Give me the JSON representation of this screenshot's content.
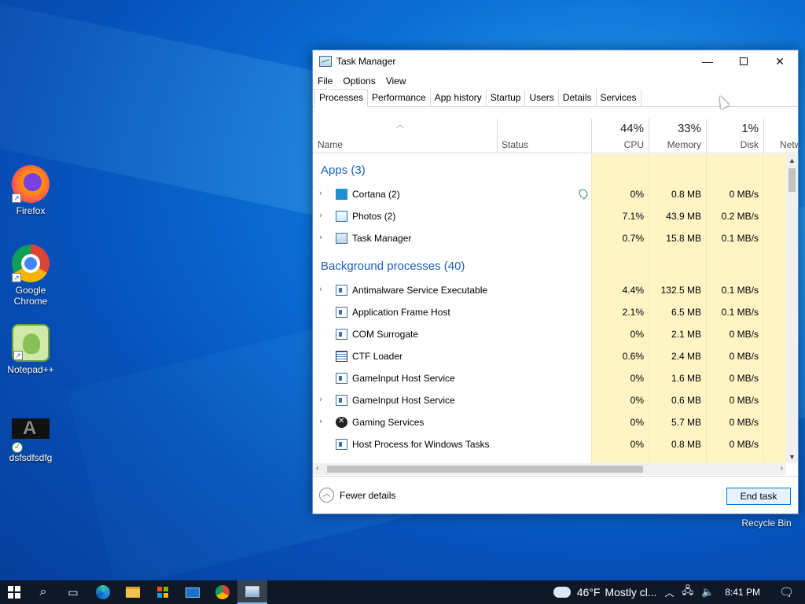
{
  "desktop": {
    "icons": [
      {
        "label": "Firefox"
      },
      {
        "label": "Google Chrome"
      },
      {
        "label": "Notepad++"
      },
      {
        "label": "dsfsdfsdfg"
      },
      {
        "label": "Recycle Bin"
      }
    ]
  },
  "window": {
    "title": "Task Manager",
    "menu": [
      "File",
      "Options",
      "View"
    ],
    "tabs": [
      "Processes",
      "Performance",
      "App history",
      "Startup",
      "Users",
      "Details",
      "Services"
    ],
    "active_tab": "Processes"
  },
  "columns": {
    "name": "Name",
    "status": "Status",
    "cpu": {
      "percent": "44%",
      "label": "CPU"
    },
    "memory": {
      "percent": "33%",
      "label": "Memory"
    },
    "disk": {
      "percent": "1%",
      "label": "Disk"
    },
    "network": {
      "label": "Netw"
    }
  },
  "groups": {
    "apps": "Apps (3)",
    "background": "Background processes (40)"
  },
  "apps": [
    {
      "name": "Cortana (2)",
      "cpu": "0%",
      "memory": "0.8 MB",
      "disk": "0 MB/s",
      "expandable": true,
      "icon": "cortana-icon",
      "suspended": true
    },
    {
      "name": "Photos (2)",
      "cpu": "7.1%",
      "memory": "43.9 MB",
      "disk": "0.2 MB/s",
      "expandable": true,
      "icon": "photos-icon"
    },
    {
      "name": "Task Manager",
      "cpu": "0.7%",
      "memory": "15.8 MB",
      "disk": "0.1 MB/s",
      "expandable": true,
      "icon": "task-manager-icon"
    }
  ],
  "background": [
    {
      "name": "Antimalware Service Executable",
      "cpu": "4.4%",
      "memory": "132.5 MB",
      "disk": "0.1 MB/s",
      "expandable": true,
      "icon": "service-icon"
    },
    {
      "name": "Application Frame Host",
      "cpu": "2.1%",
      "memory": "6.5 MB",
      "disk": "0.1 MB/s",
      "expandable": false,
      "icon": "service-icon"
    },
    {
      "name": "COM Surrogate",
      "cpu": "0%",
      "memory": "2.1 MB",
      "disk": "0 MB/s",
      "expandable": false,
      "icon": "service-icon"
    },
    {
      "name": "CTF Loader",
      "cpu": "0.6%",
      "memory": "2.4 MB",
      "disk": "0 MB/s",
      "expandable": false,
      "icon": "ctf-icon"
    },
    {
      "name": "GameInput Host Service",
      "cpu": "0%",
      "memory": "1.6 MB",
      "disk": "0 MB/s",
      "expandable": false,
      "icon": "service-icon"
    },
    {
      "name": "GameInput Host Service",
      "cpu": "0%",
      "memory": "0.6 MB",
      "disk": "0 MB/s",
      "expandable": true,
      "icon": "service-icon"
    },
    {
      "name": "Gaming Services",
      "cpu": "0%",
      "memory": "5.7 MB",
      "disk": "0 MB/s",
      "expandable": true,
      "icon": "xbox-icon"
    },
    {
      "name": "Host Process for Windows Tasks",
      "cpu": "0%",
      "memory": "0.8 MB",
      "disk": "0 MB/s",
      "expandable": false,
      "icon": "service-icon"
    }
  ],
  "footer": {
    "fewer_details": "Fewer details",
    "end_task": "End task"
  },
  "taskbar": {
    "weather_temp": "46°F",
    "weather_text": "Mostly cl...",
    "time": "8:41 PM",
    "pinned": [
      "start-icon",
      "search-icon",
      "task-view-icon",
      "edge-icon",
      "file-explorer-icon",
      "store-icon",
      "mail-icon",
      "chrome-icon",
      "task-manager-icon"
    ]
  },
  "colors": {
    "accent": "#0078d7",
    "group_text": "#1f5fb4",
    "heat_low": "#fff4c4"
  }
}
